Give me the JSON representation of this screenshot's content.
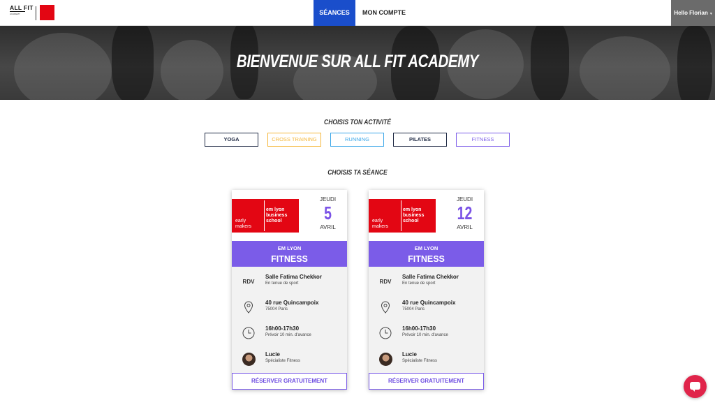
{
  "nav": {
    "brand_main": "ALL FIT",
    "brand_sub": "ACADEMY",
    "partner_logo": "em lyon business school",
    "tabs": [
      {
        "label": "SÉANCES",
        "active": true
      },
      {
        "label": "MON COMPTE",
        "active": false
      }
    ],
    "user_greeting": "Hello Florian",
    "user_caret": "▾"
  },
  "hero": {
    "title": "BIENVENUE SUR ALL FIT ACADEMY"
  },
  "activities": {
    "label": "CHOISIS TON ACTIVITÉ",
    "buttons": [
      {
        "label": "YOGA",
        "color": "#1f2a44"
      },
      {
        "label": "CROSS TRAINING",
        "color": "#f5b73a"
      },
      {
        "label": "RUNNING",
        "color": "#3aa6e8"
      },
      {
        "label": "PILATES",
        "color": "#1f2a44"
      },
      {
        "label": "FITNESS",
        "color": "#7b5ce8"
      }
    ]
  },
  "sessions": {
    "label": "CHOISIS TA SÉANCE",
    "cards": [
      {
        "logo_left": "early makers",
        "logo_right": "em lyon business school",
        "day": "JEUDI",
        "date": "5",
        "month": "AVRIL",
        "location_tag": "EM LYON",
        "activity": "FITNESS",
        "rdv_icon_label": "RDV",
        "room": "Salle Fatima Chekkor",
        "room_note": "En tenue de sport",
        "address": "40 rue Quincampoix",
        "city": "75004 Paris",
        "time": "16h00-17h30",
        "time_note": "Prévoir 10 min. d'avance",
        "coach": "Lucie",
        "coach_role": "Spécialiste Fitness",
        "cta": "RÉSERVER GRATUITEMENT"
      },
      {
        "logo_left": "early makers",
        "logo_right": "em lyon business school",
        "day": "JEUDI",
        "date": "12",
        "month": "AVRIL",
        "location_tag": "EM LYON",
        "activity": "FITNESS",
        "rdv_icon_label": "RDV",
        "room": "Salle Fatima Chekkor",
        "room_note": "En tenue de sport",
        "address": "40 rue Quincampoix",
        "city": "75004 Paris",
        "time": "16h00-17h30",
        "time_note": "Prévoir 10 min. d'avance",
        "coach": "Lucie",
        "coach_role": "Spécialiste Fitness",
        "cta": "RÉSERVER GRATUITEMENT"
      }
    ]
  },
  "colors": {
    "nav_active": "#1a4ecb",
    "accent": "#7b5ce8",
    "brand_red": "#e30613",
    "chat": "#e0244a"
  },
  "icons": [
    "map-pin-icon",
    "clock-icon",
    "chat-icon",
    "chevron-down-icon"
  ]
}
